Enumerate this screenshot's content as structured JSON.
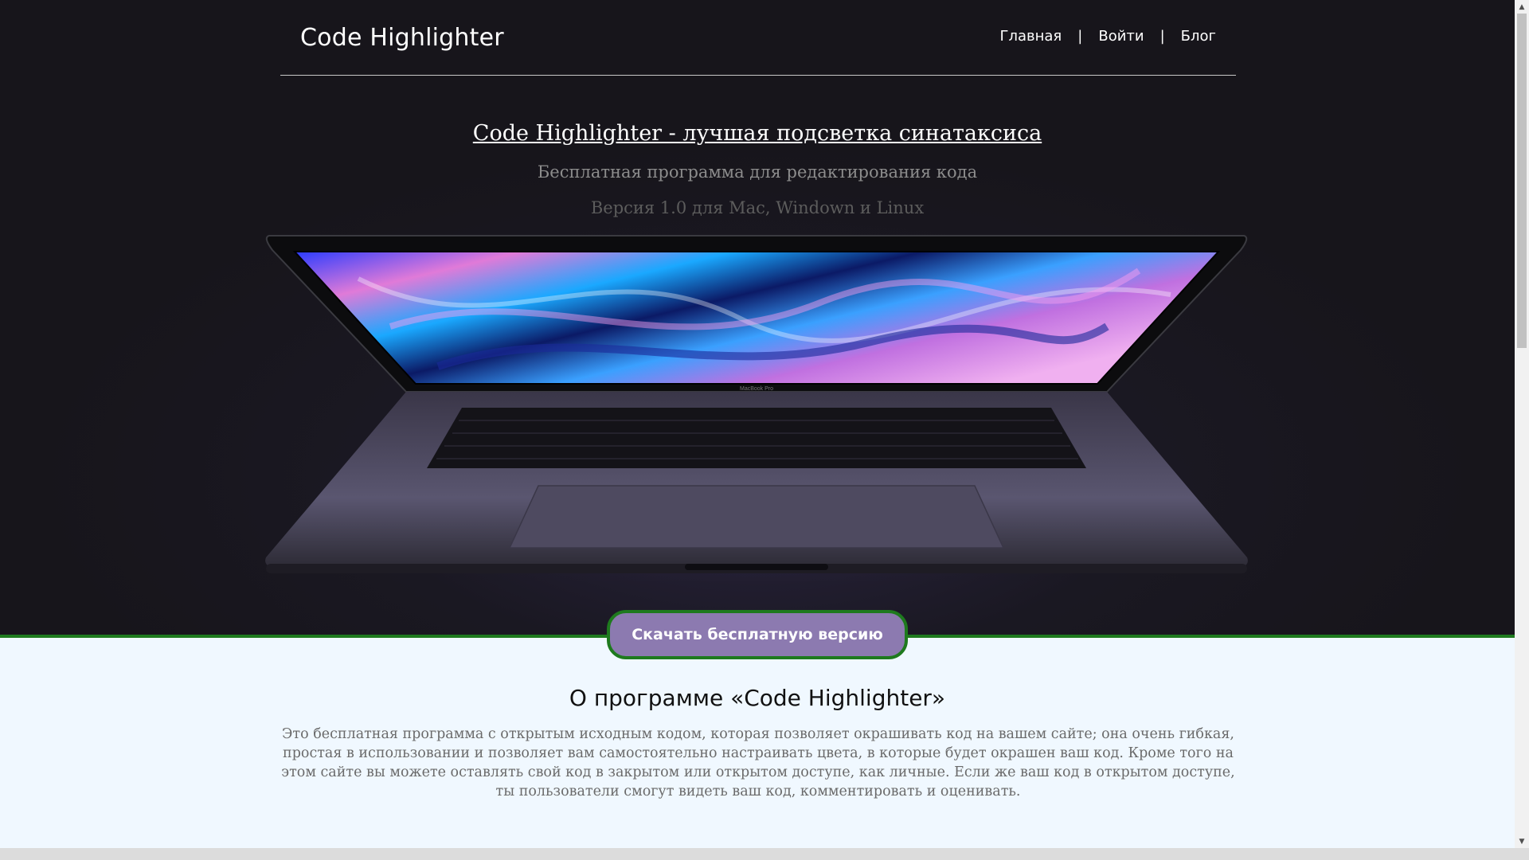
{
  "header": {
    "logo": "Code Highlighter",
    "nav": [
      {
        "label": "Главная"
      },
      {
        "label": "Войти"
      },
      {
        "label": "Блог"
      }
    ],
    "separator": "|"
  },
  "hero": {
    "title": "Code Highlighter - лучшая подсветка синатаксиса",
    "subtitle": "Бесплатная программа для редактирования кода",
    "version": "Версия 1.0 для Mac, Windown и Linux",
    "image_label": "MacBook Pro"
  },
  "download_button": {
    "label": "Скачать бесплатную версию"
  },
  "about": {
    "title": "О программе «Code Highlighter»",
    "text": "Это бесплатная программа с открытым исходным кодом, которая позволяет окрашивать код на вашем сайте; она очень гибкая, простая в использовании и позволяет вам самостоятельно настраивать цвета, в которые будет окрашен ваш код. Кроме того на этом сайте вы можете оставлять свой код в закрытом или открытом доступе, как личные. Если же ваш код в открытом доступе, ты пользователи смогут видеть ваш код, комментировать и оценивать."
  },
  "colors": {
    "hero_background": "#17151b",
    "accent_green": "#1e7a1e",
    "button_purple": "#8c7ab0",
    "about_background": "#f0f8ff"
  }
}
